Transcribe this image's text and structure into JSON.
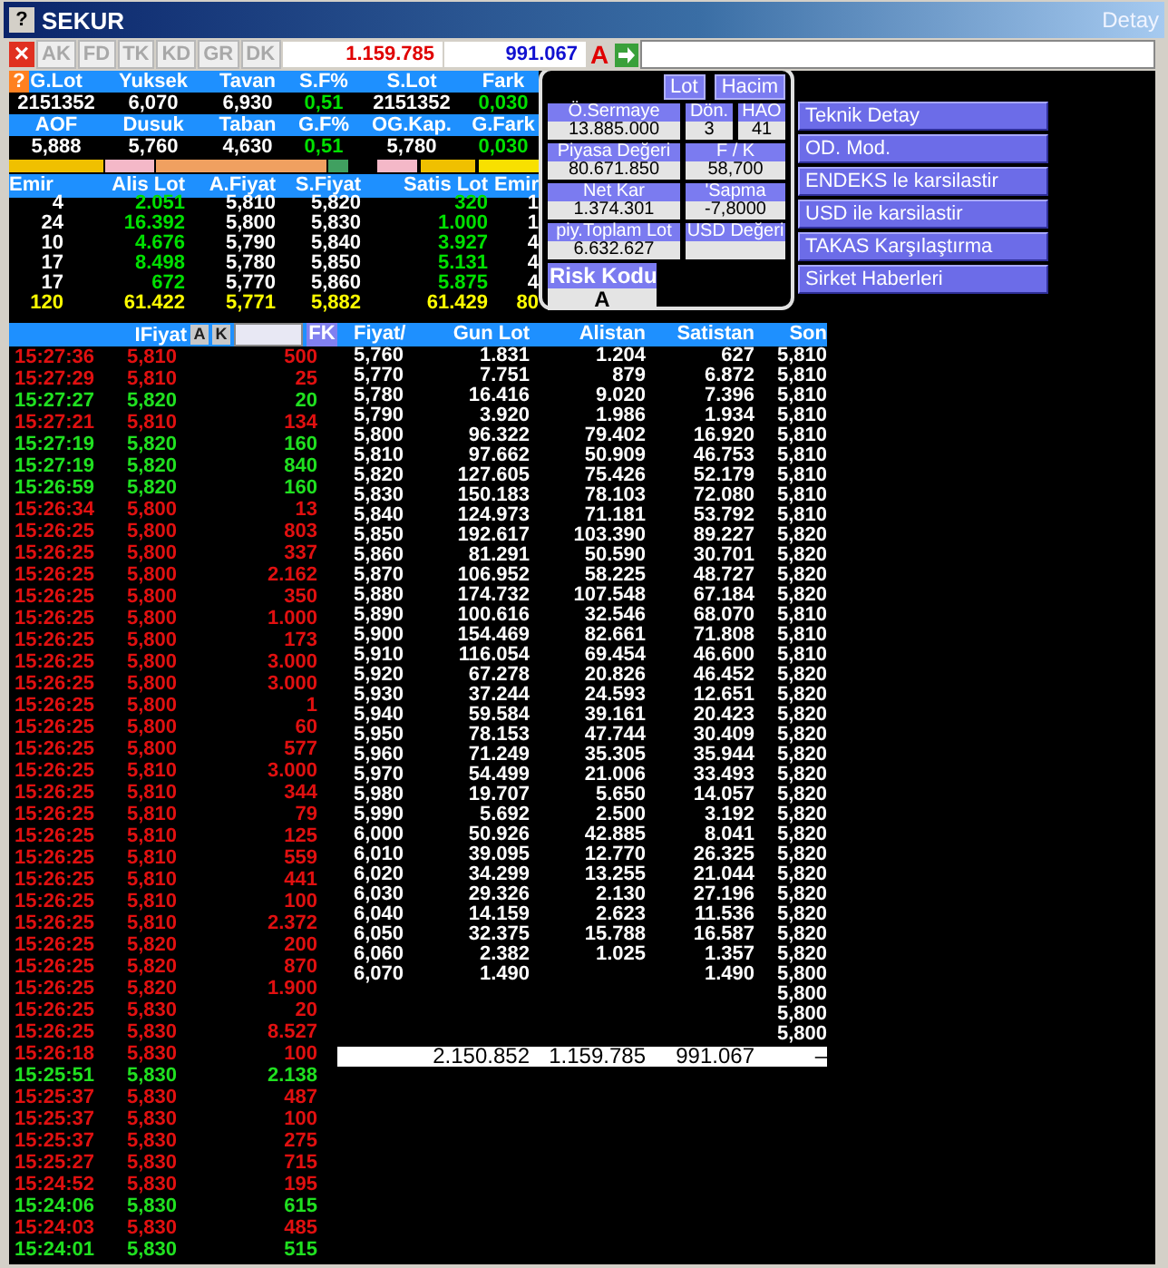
{
  "window": {
    "help": "?",
    "title": "SEKUR",
    "detail": "Detay"
  },
  "toolbar": {
    "close": "×",
    "tabs": [
      "AK",
      "FD",
      "TK",
      "KD",
      "GR",
      "DK"
    ],
    "buy_total": "1.159.785",
    "sell_total": "991.067",
    "mode": "A"
  },
  "summary": {
    "help": "?",
    "rows": [
      {
        "kind": "header",
        "cells": [
          "G.Lot",
          "Yuksek",
          "Tavan",
          "S.F%",
          "S.Lot",
          "Fark"
        ]
      },
      {
        "kind": "values",
        "cells": [
          "2151352",
          "6,070",
          "6,930",
          "0,51",
          "2151352",
          "0,030"
        ],
        "changes": [
          false,
          false,
          false,
          true,
          false,
          true
        ]
      },
      {
        "kind": "header",
        "cells": [
          "AOF",
          "Dusuk",
          "Taban",
          "G.F%",
          "OG.Kap.",
          "G.Fark"
        ]
      },
      {
        "kind": "values",
        "cells": [
          "5,888",
          "5,760",
          "4,630",
          "0,51",
          "5,780",
          "0,030"
        ],
        "changes": [
          false,
          false,
          false,
          true,
          false,
          true
        ]
      }
    ]
  },
  "depth": {
    "columns": [
      "Emir",
      "Alis Lot",
      "A.Fiyat",
      "S.Fiyat",
      "Satis Lot",
      "Emir"
    ],
    "rows": [
      {
        "kind": "level",
        "cells": [
          "4",
          "2.051",
          "5,810",
          "5,820",
          "320",
          "1"
        ]
      },
      {
        "kind": "level",
        "cells": [
          "24",
          "16.392",
          "5,800",
          "5,830",
          "1.000",
          "1"
        ]
      },
      {
        "kind": "level",
        "cells": [
          "10",
          "4.676",
          "5,790",
          "5,840",
          "3.927",
          "4"
        ]
      },
      {
        "kind": "level",
        "cells": [
          "17",
          "8.498",
          "5,780",
          "5,850",
          "5.131",
          "4"
        ]
      },
      {
        "kind": "level",
        "cells": [
          "17",
          "672",
          "5,770",
          "5,860",
          "5.875",
          "4"
        ]
      },
      {
        "kind": "total",
        "cells": [
          "120",
          "61.422",
          "5,771",
          "5,882",
          "61.429",
          "80"
        ]
      }
    ]
  },
  "info": {
    "buttons": [
      "Lot",
      "Hacim"
    ],
    "rows": [
      {
        "fields": [
          {
            "label": "Ö.Sermaye",
            "value": "13.885.000"
          },
          {
            "label": "Dön.",
            "value": "3"
          },
          {
            "label": "HAO",
            "value": "41"
          }
        ]
      },
      {
        "fields": [
          {
            "label": "Piyasa Değeri",
            "value": "80.671.850"
          },
          {
            "label": "F / K",
            "value": "58,700"
          }
        ]
      },
      {
        "fields": [
          {
            "label": "Net Kar",
            "value": "1.374.301"
          },
          {
            "label": "'Sapma",
            "value": "-7,8000"
          }
        ]
      },
      {
        "fields": [
          {
            "label": "piy.Toplam Lot",
            "value": "6.632.627"
          },
          {
            "label": "USD Değeri"
          }
        ]
      }
    ],
    "risk": {
      "label": "Risk Kodu",
      "value": "A"
    }
  },
  "menu": [
    "Teknik Detay",
    "OD. Mod.",
    "ENDEKS le karsilastir",
    "USD ile karsilastir",
    "TAKAS Karşılaştırma",
    "Sirket Haberleri"
  ],
  "trades": {
    "column": "IFiyat",
    "buttons": [
      "A",
      "K"
    ],
    "filter_button": "FK",
    "rows": [
      {
        "time": "15:27:36",
        "price": "5,810",
        "lot": "500",
        "up": false
      },
      {
        "time": "15:27:29",
        "price": "5,810",
        "lot": "25",
        "up": false
      },
      {
        "time": "15:27:27",
        "price": "5,820",
        "lot": "20",
        "up": true
      },
      {
        "time": "15:27:21",
        "price": "5,810",
        "lot": "134",
        "up": false
      },
      {
        "time": "15:27:19",
        "price": "5,820",
        "lot": "160",
        "up": true
      },
      {
        "time": "15:27:19",
        "price": "5,820",
        "lot": "840",
        "up": true
      },
      {
        "time": "15:26:59",
        "price": "5,820",
        "lot": "160",
        "up": true
      },
      {
        "time": "15:26:34",
        "price": "5,800",
        "lot": "13",
        "up": false
      },
      {
        "time": "15:26:25",
        "price": "5,800",
        "lot": "803",
        "up": false
      },
      {
        "time": "15:26:25",
        "price": "5,800",
        "lot": "337",
        "up": false
      },
      {
        "time": "15:26:25",
        "price": "5,800",
        "lot": "2.162",
        "up": false
      },
      {
        "time": "15:26:25",
        "price": "5,800",
        "lot": "350",
        "up": false
      },
      {
        "time": "15:26:25",
        "price": "5,800",
        "lot": "1.000",
        "up": false
      },
      {
        "time": "15:26:25",
        "price": "5,800",
        "lot": "173",
        "up": false
      },
      {
        "time": "15:26:25",
        "price": "5,800",
        "lot": "3.000",
        "up": false
      },
      {
        "time": "15:26:25",
        "price": "5,800",
        "lot": "3.000",
        "up": false
      },
      {
        "time": "15:26:25",
        "price": "5,800",
        "lot": "1",
        "up": false
      },
      {
        "time": "15:26:25",
        "price": "5,800",
        "lot": "60",
        "up": false
      },
      {
        "time": "15:26:25",
        "price": "5,800",
        "lot": "577",
        "up": false
      },
      {
        "time": "15:26:25",
        "price": "5,810",
        "lot": "3.000",
        "up": false
      },
      {
        "time": "15:26:25",
        "price": "5,810",
        "lot": "344",
        "up": false
      },
      {
        "time": "15:26:25",
        "price": "5,810",
        "lot": "79",
        "up": false
      },
      {
        "time": "15:26:25",
        "price": "5,810",
        "lot": "125",
        "up": false
      },
      {
        "time": "15:26:25",
        "price": "5,810",
        "lot": "559",
        "up": false
      },
      {
        "time": "15:26:25",
        "price": "5,810",
        "lot": "441",
        "up": false
      },
      {
        "time": "15:26:25",
        "price": "5,810",
        "lot": "100",
        "up": false
      },
      {
        "time": "15:26:25",
        "price": "5,810",
        "lot": "2.372",
        "up": false
      },
      {
        "time": "15:26:25",
        "price": "5,820",
        "lot": "200",
        "up": false
      },
      {
        "time": "15:26:25",
        "price": "5,820",
        "lot": "870",
        "up": false
      },
      {
        "time": "15:26:25",
        "price": "5,820",
        "lot": "1.900",
        "up": false
      },
      {
        "time": "15:26:25",
        "price": "5,830",
        "lot": "20",
        "up": false
      },
      {
        "time": "15:26:25",
        "price": "5,830",
        "lot": "8.527",
        "up": false
      },
      {
        "time": "15:26:18",
        "price": "5,830",
        "lot": "100",
        "up": false
      },
      {
        "time": "15:25:51",
        "price": "5,830",
        "lot": "2.138",
        "up": true
      },
      {
        "time": "15:25:37",
        "price": "5,830",
        "lot": "487",
        "up": false
      },
      {
        "time": "15:25:37",
        "price": "5,830",
        "lot": "100",
        "up": false
      },
      {
        "time": "15:25:37",
        "price": "5,830",
        "lot": "275",
        "up": false
      },
      {
        "time": "15:25:27",
        "price": "5,830",
        "lot": "715",
        "up": false
      },
      {
        "time": "15:24:52",
        "price": "5,830",
        "lot": "195",
        "up": false
      },
      {
        "time": "15:24:06",
        "price": "5,830",
        "lot": "615",
        "up": true
      },
      {
        "time": "15:24:03",
        "price": "5,830",
        "lot": "485",
        "up": false
      },
      {
        "time": "15:24:01",
        "price": "5,830",
        "lot": "515",
        "up": true
      }
    ]
  },
  "prices": {
    "columns": [
      "Fiyat/",
      "Gun Lot",
      "Alistan",
      "Satistan",
      "Son"
    ],
    "rows": [
      {
        "price": "5,760",
        "day_lot": "1.831",
        "bid": "1.204",
        "ask": "627",
        "last": "5,810"
      },
      {
        "price": "5,770",
        "day_lot": "7.751",
        "bid": "879",
        "ask": "6.872",
        "last": "5,810"
      },
      {
        "price": "5,780",
        "day_lot": "16.416",
        "bid": "9.020",
        "ask": "7.396",
        "last": "5,810"
      },
      {
        "price": "5,790",
        "day_lot": "3.920",
        "bid": "1.986",
        "ask": "1.934",
        "last": "5,810"
      },
      {
        "price": "5,800",
        "day_lot": "96.322",
        "bid": "79.402",
        "ask": "16.920",
        "last": "5,810"
      },
      {
        "price": "5,810",
        "day_lot": "97.662",
        "bid": "50.909",
        "ask": "46.753",
        "last": "5,810"
      },
      {
        "price": "5,820",
        "day_lot": "127.605",
        "bid": "75.426",
        "ask": "52.179",
        "last": "5,810"
      },
      {
        "price": "5,830",
        "day_lot": "150.183",
        "bid": "78.103",
        "ask": "72.080",
        "last": "5,810"
      },
      {
        "price": "5,840",
        "day_lot": "124.973",
        "bid": "71.181",
        "ask": "53.792",
        "last": "5,810"
      },
      {
        "price": "5,850",
        "day_lot": "192.617",
        "bid": "103.390",
        "ask": "89.227",
        "last": "5,820"
      },
      {
        "price": "5,860",
        "day_lot": "81.291",
        "bid": "50.590",
        "ask": "30.701",
        "last": "5,820"
      },
      {
        "price": "5,870",
        "day_lot": "106.952",
        "bid": "58.225",
        "ask": "48.727",
        "last": "5,820"
      },
      {
        "price": "5,880",
        "day_lot": "174.732",
        "bid": "107.548",
        "ask": "67.184",
        "last": "5,820"
      },
      {
        "price": "5,890",
        "day_lot": "100.616",
        "bid": "32.546",
        "ask": "68.070",
        "last": "5,810"
      },
      {
        "price": "5,900",
        "day_lot": "154.469",
        "bid": "82.661",
        "ask": "71.808",
        "last": "5,810"
      },
      {
        "price": "5,910",
        "day_lot": "116.054",
        "bid": "69.454",
        "ask": "46.600",
        "last": "5,810"
      },
      {
        "price": "5,920",
        "day_lot": "67.278",
        "bid": "20.826",
        "ask": "46.452",
        "last": "5,820"
      },
      {
        "price": "5,930",
        "day_lot": "37.244",
        "bid": "24.593",
        "ask": "12.651",
        "last": "5,820"
      },
      {
        "price": "5,940",
        "day_lot": "59.584",
        "bid": "39.161",
        "ask": "20.423",
        "last": "5,820"
      },
      {
        "price": "5,950",
        "day_lot": "78.153",
        "bid": "47.744",
        "ask": "30.409",
        "last": "5,820"
      },
      {
        "price": "5,960",
        "day_lot": "71.249",
        "bid": "35.305",
        "ask": "35.944",
        "last": "5,820"
      },
      {
        "price": "5,970",
        "day_lot": "54.499",
        "bid": "21.006",
        "ask": "33.493",
        "last": "5,820"
      },
      {
        "price": "5,980",
        "day_lot": "19.707",
        "bid": "5.650",
        "ask": "14.057",
        "last": "5,820"
      },
      {
        "price": "5,990",
        "day_lot": "5.692",
        "bid": "2.500",
        "ask": "3.192",
        "last": "5,820"
      },
      {
        "price": "6,000",
        "day_lot": "50.926",
        "bid": "42.885",
        "ask": "8.041",
        "last": "5,820"
      },
      {
        "price": "6,010",
        "day_lot": "39.095",
        "bid": "12.770",
        "ask": "26.325",
        "last": "5,820"
      },
      {
        "price": "6,020",
        "day_lot": "34.299",
        "bid": "13.255",
        "ask": "21.044",
        "last": "5,820"
      },
      {
        "price": "6,030",
        "day_lot": "29.326",
        "bid": "2.130",
        "ask": "27.196",
        "last": "5,820"
      },
      {
        "price": "6,040",
        "day_lot": "14.159",
        "bid": "2.623",
        "ask": "11.536",
        "last": "5,820"
      },
      {
        "price": "6,050",
        "day_lot": "32.375",
        "bid": "15.788",
        "ask": "16.587",
        "last": "5,820"
      },
      {
        "price": "6,060",
        "day_lot": "2.382",
        "bid": "1.025",
        "ask": "1.357",
        "last": "5,820"
      },
      {
        "price": "6,070",
        "day_lot": "1.490",
        "ask": "1.490",
        "last": "5,800"
      },
      {
        "last": "5,800"
      },
      {
        "last": "5,800"
      },
      {
        "last": "5,800"
      }
    ],
    "totals": {
      "day_lot": "2.150.852",
      "bid": "1.159.785",
      "ask": "991.067",
      "last": "–"
    }
  }
}
